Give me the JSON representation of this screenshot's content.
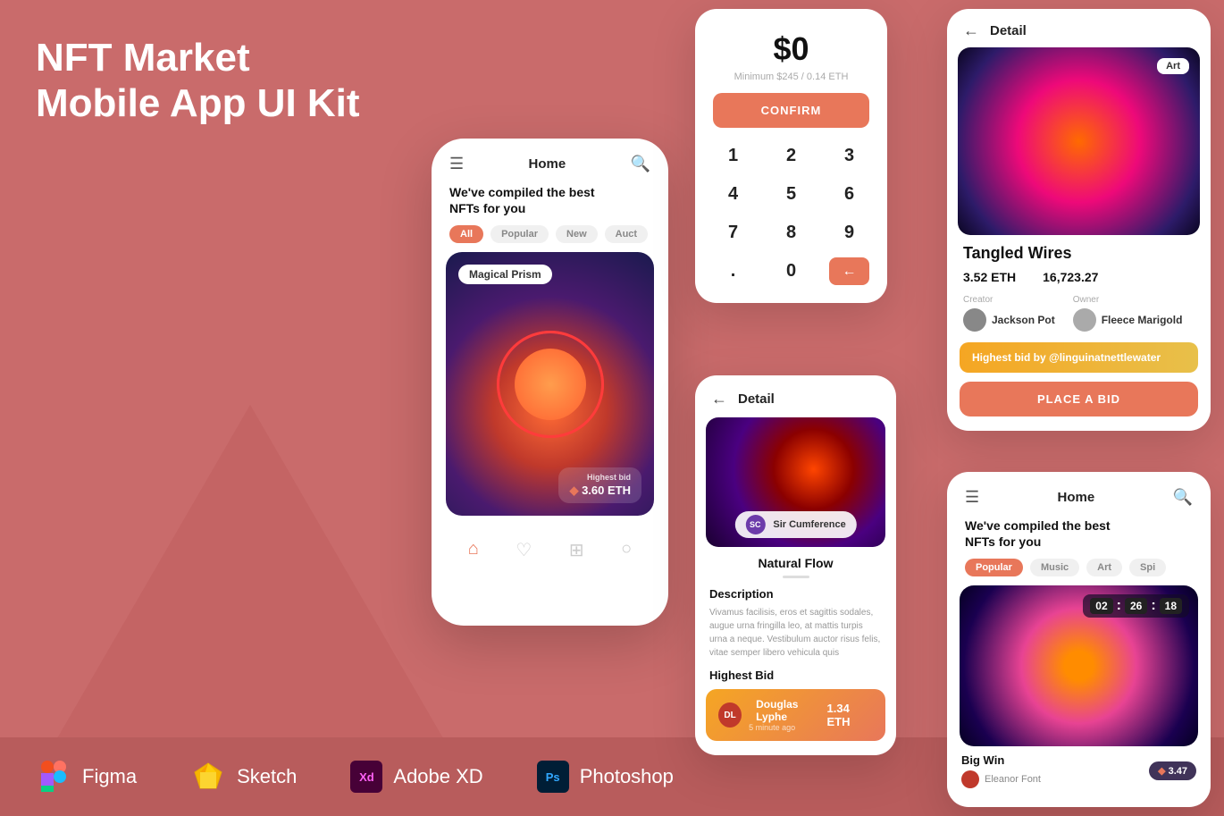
{
  "background": "#c96b6b",
  "title": {
    "line1": "NFT Market",
    "line2": "Mobile App UI Kit"
  },
  "tools": [
    {
      "name": "Figma",
      "icon": "figma",
      "color": "#ff4f17"
    },
    {
      "name": "Sketch",
      "icon": "sketch",
      "color": "#f7b500"
    },
    {
      "name": "Adobe XD",
      "icon": "xd",
      "color": "#470137"
    },
    {
      "name": "Photoshop",
      "icon": "ps",
      "color": "#001e36"
    }
  ],
  "phone_main": {
    "header_title": "Home",
    "subtitle": "We've compiled the best\nNFTs for you",
    "tabs": [
      "All",
      "Popular",
      "New",
      "Auct"
    ],
    "active_tab": "All",
    "card": {
      "label": "Magical Prism",
      "bid_label": "Highest bid",
      "bid_value": "3.60 ETH"
    }
  },
  "numpad": {
    "amount": "$0",
    "min_text": "Minimum $245 / 0.14 ETH",
    "confirm_label": "CONFIRM",
    "keys": [
      "1",
      "2",
      "3",
      "4",
      "5",
      "6",
      "7",
      "8",
      "9",
      ".",
      "0",
      "←"
    ]
  },
  "detail_mid": {
    "header": "Detail",
    "sc_badge": "Sir Cumference",
    "nft_name": "Natural Flow",
    "desc_title": "Description",
    "desc_text": "Vivamus facilisis, eros et sagittis sodales, augue urna fringilla leo, at mattis turpis urna a neque. Vestibulum auctor risus felis, vitae semper libero vehicula quis",
    "highest_bid_title": "Highest Bid",
    "bid": {
      "initials": "DL",
      "name": "Douglas Lyphe",
      "time": "5 minute ago",
      "amount": "1.34 ETH"
    }
  },
  "detail_right": {
    "header": "Detail",
    "art_badge": "Art",
    "nft_name": "Tangled Wires",
    "eth_value1": "3.52 ETH",
    "eth_value2": "16,723.27",
    "creator_label": "Creator",
    "creator_name": "Jackson Pot",
    "owner_label": "Owner",
    "owner_name": "Fleece Marigold",
    "highest_bid_text": "Highest bid by @linguinatnettlewater",
    "place_bid_label": "PLACE A BID"
  },
  "phone_bottom_right": {
    "header_title": "Home",
    "subtitle": "We've compiled the best\nNFTs for you",
    "tabs": [
      "Popular",
      "Music",
      "Art",
      "Spi"
    ],
    "active_tab": "Popular",
    "timer": {
      "h": "02",
      "m": "26",
      "s": "18"
    },
    "card": {
      "title": "Big Win",
      "creator": "Eleanor Font",
      "eth": "3.47"
    }
  }
}
